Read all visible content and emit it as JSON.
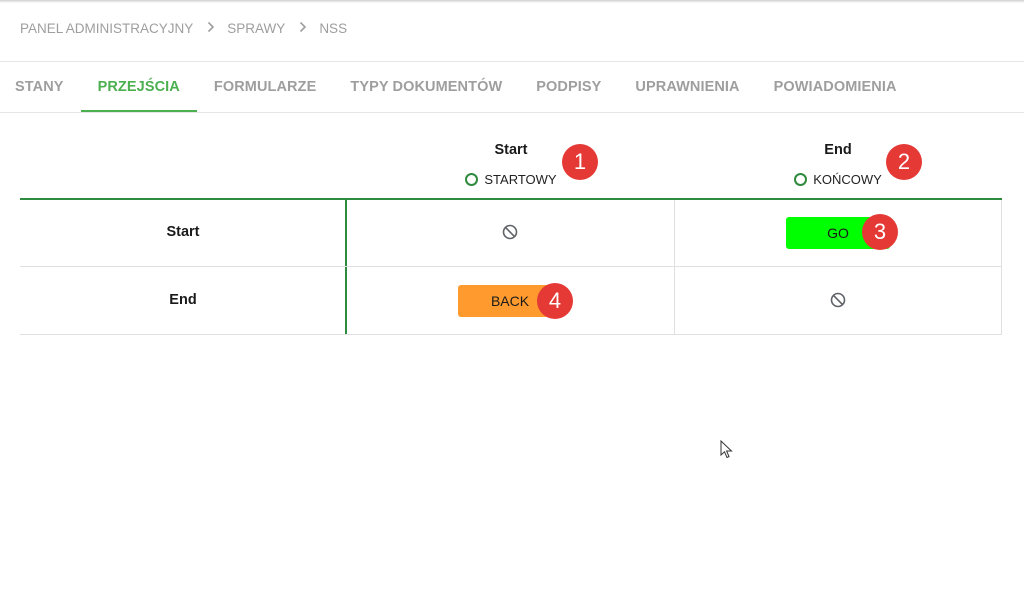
{
  "breadcrumb": [
    "PANEL ADMINISTRACYJNY",
    "SPRAWY",
    "NSS"
  ],
  "tabs": [
    {
      "label": "STANY",
      "active": false
    },
    {
      "label": "PRZEJŚCIA",
      "active": true
    },
    {
      "label": "FORMULARZE",
      "active": false
    },
    {
      "label": "TYPY DOKUMENTÓW",
      "active": false
    },
    {
      "label": "PODPISY",
      "active": false
    },
    {
      "label": "UPRAWNIENIA",
      "active": false
    },
    {
      "label": "POWIADOMIENIA",
      "active": false
    }
  ],
  "columns": [
    {
      "title": "Start",
      "type": "STARTOWY",
      "badge": "1"
    },
    {
      "title": "End",
      "type": "KOŃCOWY",
      "badge": "2"
    }
  ],
  "rows": [
    {
      "label": "Start"
    },
    {
      "label": "End"
    }
  ],
  "cells": {
    "start_start": "blocked",
    "start_end": {
      "label": "GO",
      "badge": "3",
      "color": "#00ff00"
    },
    "end_start": {
      "label": "BACK",
      "badge": "4",
      "color": "#ff9b2e"
    },
    "end_end": "blocked"
  },
  "colors": {
    "accent": "#4caf50",
    "grid": "#2e8b3e",
    "badge": "#e53935"
  }
}
